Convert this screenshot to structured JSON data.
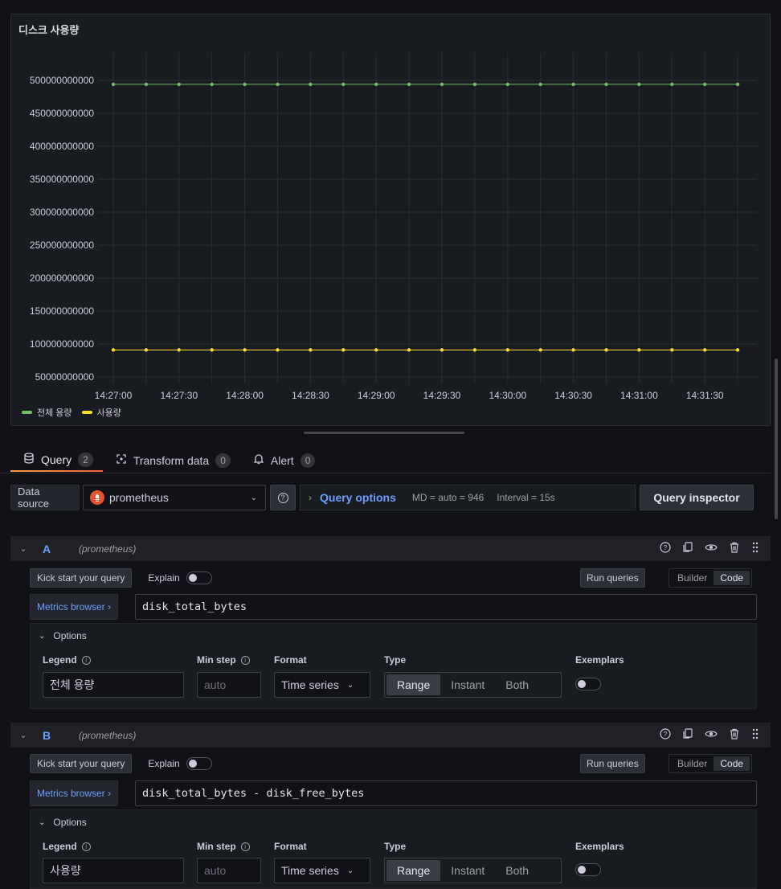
{
  "panel": {
    "title": "디스크 사용량",
    "legend": [
      {
        "name": "전체 용량",
        "color": "#73bf69"
      },
      {
        "name": "사용량",
        "color": "#fade2a"
      }
    ]
  },
  "chart_data": {
    "type": "line",
    "title": "디스크 사용량",
    "xlabel": "",
    "ylabel": "",
    "x": [
      "14:27:00",
      "14:27:15",
      "14:27:30",
      "14:27:45",
      "14:28:00",
      "14:28:15",
      "14:28:30",
      "14:28:45",
      "14:29:00",
      "14:29:15",
      "14:29:30",
      "14:29:45",
      "14:30:00",
      "14:30:15",
      "14:30:30",
      "14:30:45",
      "14:31:00",
      "14:31:15",
      "14:31:30",
      "14:31:45"
    ],
    "x_ticks": [
      "14:27:00",
      "14:27:30",
      "14:28:00",
      "14:28:30",
      "14:29:00",
      "14:29:30",
      "14:30:00",
      "14:30:30",
      "14:31:00",
      "14:31:30"
    ],
    "y_ticks": [
      "500000000000",
      "450000000000",
      "400000000000",
      "350000000000",
      "300000000000",
      "250000000000",
      "200000000000",
      "150000000000",
      "100000000000",
      "50000000000"
    ],
    "ylim": [
      40000000000,
      520000000000
    ],
    "grid": true,
    "legend_position": "bottom-left",
    "series": [
      {
        "name": "전체 용량",
        "color": "#73bf69",
        "values": [
          494000000000,
          494000000000,
          494000000000,
          494000000000,
          494000000000,
          494000000000,
          494000000000,
          494000000000,
          494000000000,
          494000000000,
          494000000000,
          494000000000,
          494000000000,
          494000000000,
          494000000000,
          494000000000,
          494000000000,
          494000000000,
          494000000000,
          494000000000
        ]
      },
      {
        "name": "사용량",
        "color": "#fade2a",
        "values": [
          91000000000,
          91000000000,
          91000000000,
          91000000000,
          91000000000,
          91000000000,
          91000000000,
          91000000000,
          91000000000,
          91000000000,
          91000000000,
          91000000000,
          91000000000,
          91000000000,
          91000000000,
          91000000000,
          91000000000,
          91000000000,
          91000000000,
          91000000000
        ]
      }
    ]
  },
  "tabs": [
    {
      "label": "Query",
      "count": "2",
      "icon": "database-icon"
    },
    {
      "label": "Transform data",
      "count": "0",
      "icon": "transform-icon"
    },
    {
      "label": "Alert",
      "count": "0",
      "icon": "bell-icon"
    }
  ],
  "datasource": {
    "label": "Data source",
    "value": "prometheus",
    "query_options_title": "Query options",
    "md": "MD = auto = 946",
    "interval": "Interval = 15s",
    "inspector": "Query inspector"
  },
  "queries": [
    {
      "ref": "A",
      "ds": "(prometheus)",
      "kick": "Kick start your query",
      "explain": "Explain",
      "run": "Run queries",
      "builder": "Builder",
      "code": "Code",
      "metrics_browser": "Metrics browser ›",
      "expr": "disk_total_bytes",
      "options": "Options",
      "legend_label": "Legend",
      "legend_value": "전체 용량",
      "minstep_label": "Min step",
      "minstep_placeholder": "auto",
      "format_label": "Format",
      "format_value": "Time series",
      "type_label": "Type",
      "type_options": [
        "Range",
        "Instant",
        "Both"
      ],
      "exemplars_label": "Exemplars"
    },
    {
      "ref": "B",
      "ds": "(prometheus)",
      "kick": "Kick start your query",
      "explain": "Explain",
      "run": "Run queries",
      "builder": "Builder",
      "code": "Code",
      "metrics_browser": "Metrics browser ›",
      "expr": "disk_total_bytes - disk_free_bytes",
      "options": "Options",
      "legend_label": "Legend",
      "legend_value": "사용량",
      "minstep_label": "Min step",
      "minstep_placeholder": "auto",
      "format_label": "Format",
      "format_value": "Time series",
      "type_label": "Type",
      "type_options": [
        "Range",
        "Instant",
        "Both"
      ],
      "exemplars_label": "Exemplars"
    }
  ]
}
